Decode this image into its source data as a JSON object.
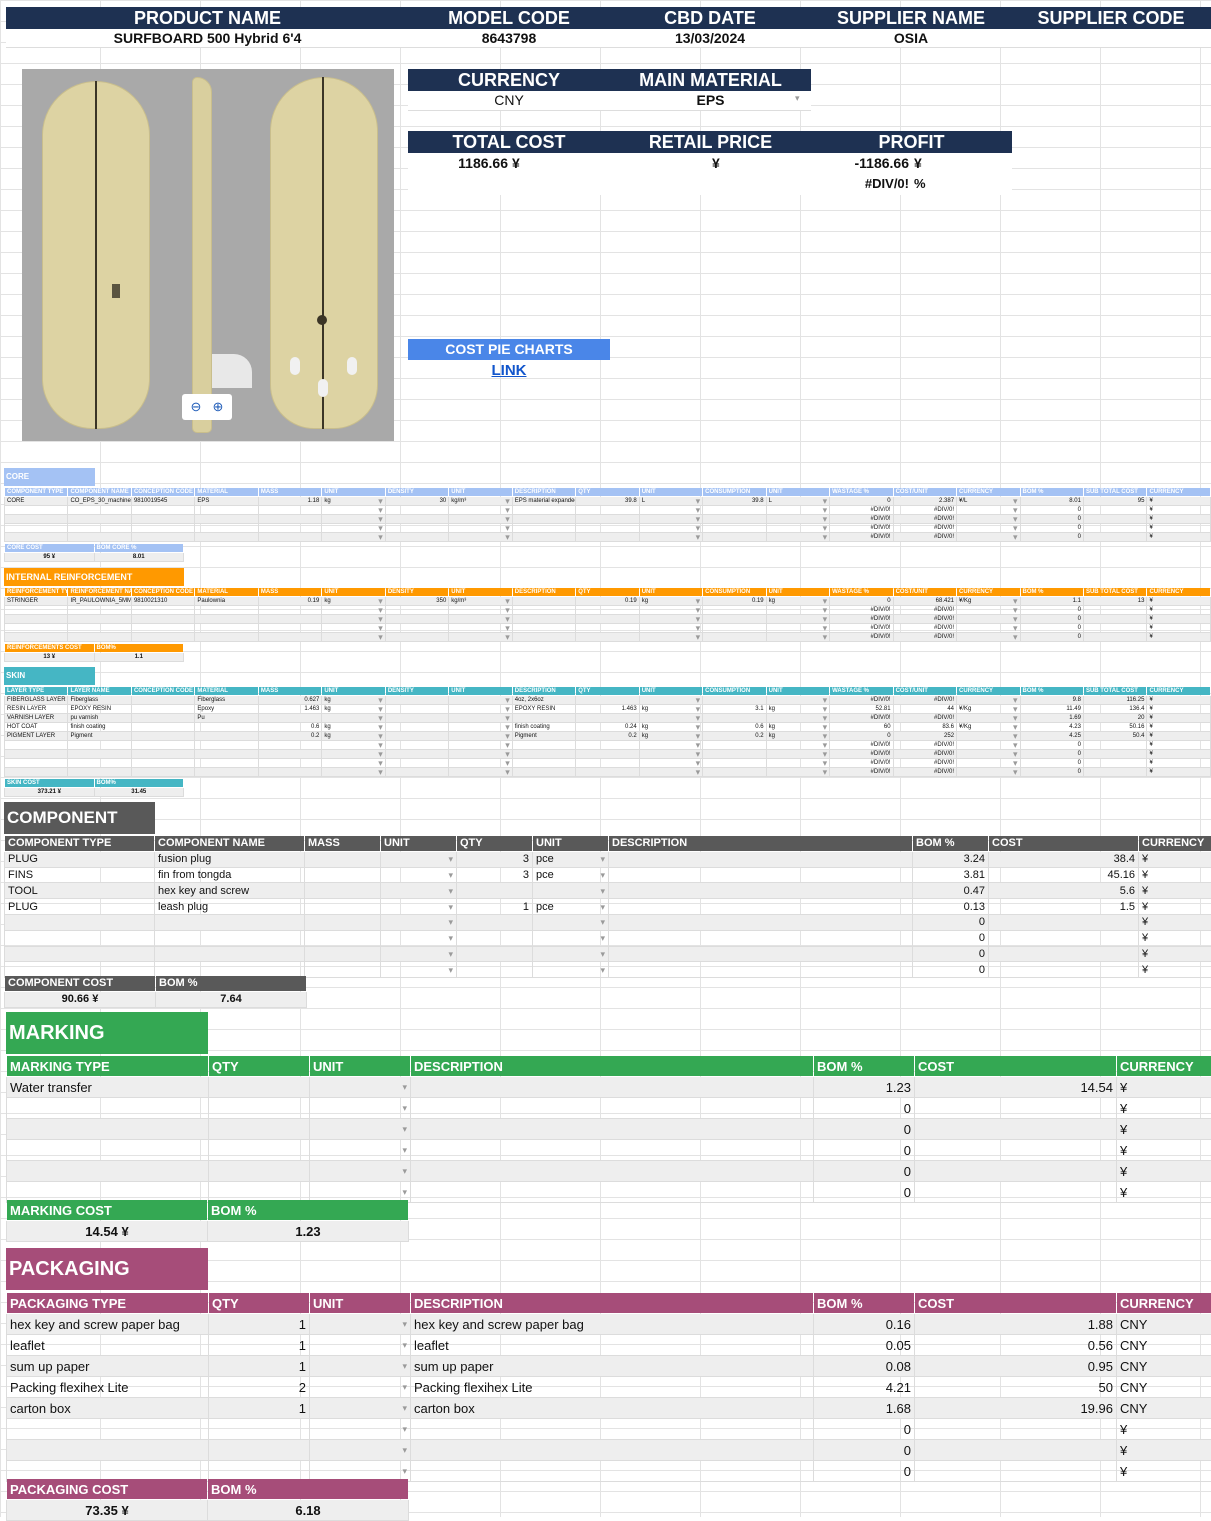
{
  "header": {
    "product_name_label": "PRODUCT NAME",
    "product_name": "SURFBOARD 500 Hybrid 6'4",
    "model_code_label": "MODEL CODE",
    "model_code": "8643798",
    "cbd_date_label": "CBD DATE",
    "cbd_date": "13/03/2024",
    "supplier_name_label": "SUPPLIER NAME",
    "supplier_name": "OSIA",
    "supplier_code_label": "SUPPLIER CODE"
  },
  "summary": {
    "currency_label": "CURRENCY",
    "currency": "CNY",
    "main_material_label": "MAIN MATERIAL",
    "main_material": "EPS",
    "total_cost_label": "TOTAL COST",
    "total_cost": "1186.66",
    "total_cost_cur": "¥",
    "retail_price_label": "RETAIL PRICE",
    "retail_price_cur": "¥",
    "profit_label": "PROFIT",
    "profit": "-1186.66",
    "profit_cur": "¥",
    "profit_pct": "#DIV/0!",
    "profit_pct_sym": "%",
    "pie_label": "COST PIE CHARTS",
    "link": "LINK"
  },
  "core": {
    "title": "CORE",
    "headers": [
      "COMPONENT TYPE",
      "COMPONENT NAME",
      "CONCEPTION CODE",
      "MATERIAL",
      "MASS",
      "UNIT",
      "DENSITY",
      "UNIT",
      "DESCRIPTION",
      "QTY",
      "UNIT",
      "CONSUMPTION",
      "UNIT",
      "WASTAGE %",
      "COST/UNIT",
      "CURRENCY",
      "BOM %",
      "SUB TOTAL COST",
      "CURRENCY"
    ],
    "rows": [
      [
        "CORE",
        "CO_EPS_30_machined",
        "9810019545",
        "EPS",
        "1.18",
        "kg",
        "30",
        "kg/m³",
        "EPS material expanded and machined using AKU",
        "39.8",
        "L",
        "39.8",
        "L",
        "0",
        "2.387",
        "¥/L",
        "8.01",
        "95",
        "¥"
      ],
      [
        "",
        "",
        "",
        "",
        "",
        "",
        "",
        "",
        "",
        "",
        "",
        "",
        "",
        "#DIV/0!",
        "#DIV/0!",
        "",
        "0",
        "",
        "¥"
      ],
      [
        "",
        "",
        "",
        "",
        "",
        "",
        "",
        "",
        "",
        "",
        "",
        "",
        "",
        "#DIV/0!",
        "#DIV/0!",
        "",
        "0",
        "",
        "¥"
      ],
      [
        "",
        "",
        "",
        "",
        "",
        "",
        "",
        "",
        "",
        "",
        "",
        "",
        "",
        "#DIV/0!",
        "#DIV/0!",
        "",
        "0",
        "",
        "¥"
      ],
      [
        "",
        "",
        "",
        "",
        "",
        "",
        "",
        "",
        "",
        "",
        "",
        "",
        "",
        "#DIV/0!",
        "#DIV/0!",
        "",
        "0",
        "",
        "¥"
      ]
    ],
    "cost_label": "CORE COST",
    "bom_label": "BOM CORE %",
    "cost": "95",
    "cur": "¥",
    "bom": "8.01"
  },
  "reinforcement": {
    "title": "INTERNAL REINFORCEMENT",
    "headers": [
      "REINFORCEMENT TYPE",
      "REINFORCEMENT NAME",
      "CONCEPTION CODE",
      "MATERIAL",
      "MASS",
      "UNIT",
      "DENSITY",
      "UNIT",
      "DESCRIPTION",
      "QTY",
      "UNIT",
      "CONSUMPTION",
      "UNIT",
      "WASTAGE %",
      "COST/UNIT",
      "CURRENCY",
      "BOM %",
      "SUB TOTAL COST",
      "CURRENCY"
    ],
    "rows": [
      [
        "STRINGER",
        "IR_PAULOWNIA_5MM",
        "9810021310",
        "Paulownia",
        "0.19",
        "kg",
        "350",
        "kg/m³",
        "",
        "0.19",
        "kg",
        "0.19",
        "kg",
        "0",
        "68.421",
        "¥/Kg",
        "1.1",
        "13",
        "¥"
      ],
      [
        "",
        "",
        "",
        "",
        "",
        "",
        "",
        "",
        "",
        "",
        "",
        "",
        "",
        "#DIV/0!",
        "#DIV/0!",
        "",
        "0",
        "",
        "¥"
      ],
      [
        "",
        "",
        "",
        "",
        "",
        "",
        "",
        "",
        "",
        "",
        "",
        "",
        "",
        "#DIV/0!",
        "#DIV/0!",
        "",
        "0",
        "",
        "¥"
      ],
      [
        "",
        "",
        "",
        "",
        "",
        "",
        "",
        "",
        "",
        "",
        "",
        "",
        "",
        "#DIV/0!",
        "#DIV/0!",
        "",
        "0",
        "",
        "¥"
      ],
      [
        "",
        "",
        "",
        "",
        "",
        "",
        "",
        "",
        "",
        "",
        "",
        "",
        "",
        "#DIV/0!",
        "#DIV/0!",
        "",
        "0",
        "",
        "¥"
      ]
    ],
    "cost_label": "REINFORCEMENTS COST",
    "bom_label": "BOM%",
    "cost": "13",
    "cur": "¥",
    "bom": "1.1"
  },
  "skin": {
    "title": "SKIN",
    "headers": [
      "LAYER TYPE",
      "LAYER NAME",
      "CONCEPTION CODE",
      "MATERIAL",
      "MASS",
      "UNIT",
      "DENSITY",
      "UNIT",
      "DESCRIPTION",
      "QTY",
      "UNIT",
      "CONSUMPTION",
      "UNIT",
      "WASTAGE %",
      "COST/UNIT",
      "CURRENCY",
      "BOM %",
      "SUB TOTAL COST",
      "CURRENCY"
    ],
    "rows": [
      [
        "FIBERGLASS LAYER",
        "Fiberglass",
        "",
        "Fiberglass",
        "0.627",
        "kg",
        "",
        "",
        "4oz, 2x6oz",
        "",
        "",
        "",
        "",
        "#DIV/0!",
        "#DIV/0!",
        "",
        "9.8",
        "116.25",
        "¥"
      ],
      [
        "RESIN LAYER",
        "EPOXY RESIN",
        "",
        "Epoxy",
        "1.463",
        "kg",
        "",
        "",
        "EPOXY RESIN",
        "1.463",
        "kg",
        "3.1",
        "kg",
        "52.81",
        "44",
        "¥/Kg",
        "11.49",
        "136.4",
        "¥"
      ],
      [
        "VARNISH LAYER",
        "pu varnish",
        "",
        "Pu",
        "",
        "",
        "",
        "",
        "",
        "",
        "",
        "",
        "",
        "#DIV/0!",
        "#DIV/0!",
        "",
        "1.69",
        "20",
        "¥"
      ],
      [
        "HOT COAT",
        "finish coating",
        "",
        "",
        "0.6",
        "kg",
        "",
        "",
        "finish coating",
        "0.24",
        "kg",
        "0.6",
        "kg",
        "60",
        "83.6",
        "¥/Kg",
        "4.23",
        "50.16",
        "¥"
      ],
      [
        "PIGMENT LAYER",
        "Pigment",
        "",
        "",
        "0.2",
        "kg",
        "",
        "",
        "Pigment",
        "0.2",
        "kg",
        "0.2",
        "kg",
        "0",
        "252",
        "",
        "4.25",
        "50.4",
        "¥"
      ],
      [
        "",
        "",
        "",
        "",
        "",
        "",
        "",
        "",
        "",
        "",
        "",
        "",
        "",
        "#DIV/0!",
        "#DIV/0!",
        "",
        "0",
        "",
        "¥"
      ],
      [
        "",
        "",
        "",
        "",
        "",
        "",
        "",
        "",
        "",
        "",
        "",
        "",
        "",
        "#DIV/0!",
        "#DIV/0!",
        "",
        "0",
        "",
        "¥"
      ],
      [
        "",
        "",
        "",
        "",
        "",
        "",
        "",
        "",
        "",
        "",
        "",
        "",
        "",
        "#DIV/0!",
        "#DIV/0!",
        "",
        "0",
        "",
        "¥"
      ],
      [
        "",
        "",
        "",
        "",
        "",
        "",
        "",
        "",
        "",
        "",
        "",
        "",
        "",
        "#DIV/0!",
        "#DIV/0!",
        "",
        "0",
        "",
        "¥"
      ]
    ],
    "cost_label": "SKIN COST",
    "bom_label": "BOM%",
    "cost": "373.21",
    "cur": "¥",
    "bom": "31.45"
  },
  "component": {
    "title": "COMPONENT",
    "headers": [
      "COMPONENT TYPE",
      "COMPONENT NAME",
      "MASS",
      "UNIT",
      "QTY",
      "UNIT",
      "DESCRIPTION",
      "BOM %",
      "COST",
      "CURRENCY"
    ],
    "rows": [
      [
        "PLUG",
        "fusion plug",
        "",
        "",
        "3",
        "pce",
        "",
        "3.24",
        "38.4",
        "¥"
      ],
      [
        "FINS",
        "fin from tongda",
        "",
        "",
        "3",
        "pce",
        "",
        "3.81",
        "45.16",
        "¥"
      ],
      [
        "TOOL",
        "hex key and screw",
        "",
        "",
        "",
        "",
        "",
        "0.47",
        "5.6",
        "¥"
      ],
      [
        "PLUG",
        "leash plug",
        "",
        "",
        "1",
        "pce",
        "",
        "0.13",
        "1.5",
        "¥"
      ],
      [
        "",
        "",
        "",
        "",
        "",
        "",
        "",
        "0",
        "",
        "¥"
      ],
      [
        "",
        "",
        "",
        "",
        "",
        "",
        "",
        "0",
        "",
        "¥"
      ],
      [
        "",
        "",
        "",
        "",
        "",
        "",
        "",
        "0",
        "",
        "¥"
      ],
      [
        "",
        "",
        "",
        "",
        "",
        "",
        "",
        "0",
        "",
        "¥"
      ]
    ],
    "cost_label": "COMPONENT COST",
    "bom_label": "BOM %",
    "cost": "90.66",
    "cur": "¥",
    "bom": "7.64"
  },
  "marking": {
    "title": "MARKING",
    "headers": [
      "MARKING TYPE",
      "QTY",
      "UNIT",
      "DESCRIPTION",
      "BOM %",
      "COST",
      "CURRENCY"
    ],
    "rows": [
      [
        "Water transfer",
        "",
        "",
        "",
        "1.23",
        "14.54",
        "¥"
      ],
      [
        "",
        "",
        "",
        "",
        "0",
        "",
        "¥"
      ],
      [
        "",
        "",
        "",
        "",
        "0",
        "",
        "¥"
      ],
      [
        "",
        "",
        "",
        "",
        "0",
        "",
        "¥"
      ],
      [
        "",
        "",
        "",
        "",
        "0",
        "",
        "¥"
      ],
      [
        "",
        "",
        "",
        "",
        "0",
        "",
        "¥"
      ]
    ],
    "cost_label": "MARKING COST",
    "bom_label": "BOM %",
    "cost": "14.54",
    "cur": "¥",
    "bom": "1.23"
  },
  "packaging": {
    "title": "PACKAGING",
    "headers": [
      "PACKAGING TYPE",
      "QTY",
      "UNIT",
      "DESCRIPTION",
      "BOM %",
      "COST",
      "CURRENCY"
    ],
    "rows": [
      [
        "hex key and screw paper bag",
        "1",
        "",
        "hex key and screw paper bag",
        "0.16",
        "1.88",
        "CNY"
      ],
      [
        "leaflet",
        "1",
        "",
        "leaflet",
        "0.05",
        "0.56",
        "CNY"
      ],
      [
        "sum up paper",
        "1",
        "",
        "sum up paper",
        "0.08",
        "0.95",
        "CNY"
      ],
      [
        "Packing flexihex Lite",
        "2",
        "",
        "Packing flexihex Lite",
        "4.21",
        "50",
        "CNY"
      ],
      [
        "carton box",
        "1",
        "",
        "carton box",
        "1.68",
        "19.96",
        "CNY"
      ],
      [
        "",
        "",
        "",
        "",
        "0",
        "",
        "¥"
      ],
      [
        "",
        "",
        "",
        "",
        "0",
        "",
        "¥"
      ],
      [
        "",
        "",
        "",
        "",
        "0",
        "",
        "¥"
      ]
    ],
    "cost_label": "PACKAGING COST",
    "bom_label": "BOM %",
    "cost": "73.35",
    "cur": "¥",
    "bom": "6.18"
  },
  "colors": {
    "header": "#1e3152",
    "core": "#a4c2f4",
    "reinforcement": "#ff9900",
    "skin": "#45b6c4",
    "component": "#595959",
    "marking": "#34a853",
    "packaging": "#a64d79",
    "link": "#1155cc"
  },
  "icons": [
    "zoom-out-icon",
    "zoom-in-icon",
    "dropdown-arrow-icon"
  ]
}
